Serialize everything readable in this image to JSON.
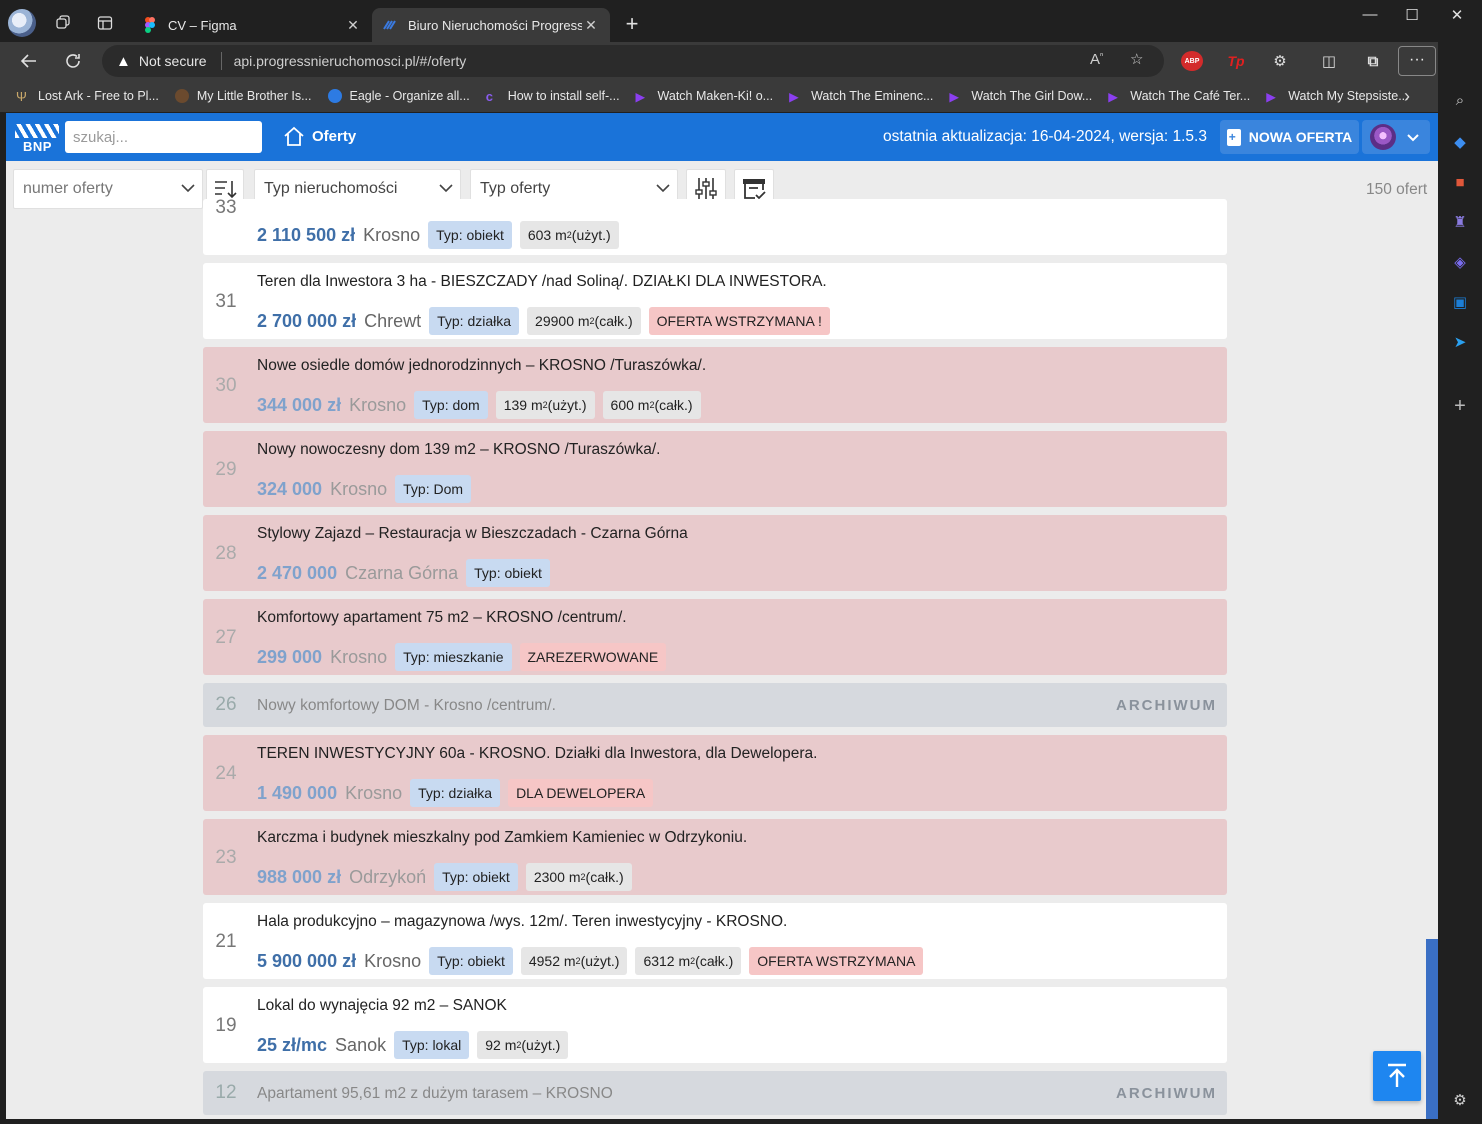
{
  "browser": {
    "tabs": [
      {
        "title": "CV – Figma",
        "active": false
      },
      {
        "title": "Biuro Nieruchomości Progress - B",
        "active": true
      }
    ],
    "not_secure": "Not secure",
    "url": "api.progressnieruchomosci.pl/#/oferty",
    "bookmarks": [
      "Lost Ark - Free to Pl...",
      "My Little Brother Is...",
      "Eagle - Organize all...",
      "How to install self-...",
      "Watch Maken-Ki! o...",
      "Watch The Eminenc...",
      "Watch The Girl Dow...",
      "Watch The Café Ter...",
      "Watch My Stepsiste..."
    ],
    "ext_abp": "ABP",
    "ext_tp": "Tp"
  },
  "app": {
    "logo": "BNP",
    "search_placeholder": "szukaj...",
    "nav_oferty": "Oferty",
    "update_text": "ostatnia aktualizacja: 16-04-2024, wersja: 1.5.3",
    "new_offer_button": "NOWA OFERTA"
  },
  "filters": {
    "offer_number_placeholder": "numer oferty",
    "property_type_placeholder": "Typ nieruchomości",
    "offer_type_placeholder": "Typ oferty",
    "count": "150 ofert"
  },
  "offers": [
    {
      "num": "33",
      "price": "2 110 500 zł",
      "city": "Krosno",
      "tags": [
        {
          "k": "typ",
          "t": "Typ: obiekt"
        },
        {
          "k": "area",
          "t": "603 m",
          "sup": "2",
          "after": "(użyt.)"
        }
      ]
    },
    {
      "num": "31",
      "title": "Teren dla Inwestora 3 ha - BIESZCZADY /nad Soliną/. DZIAŁKI DLA INWESTORA.",
      "price": "2 700 000 zł",
      "city": "Chrewt",
      "tags": [
        {
          "k": "typ",
          "t": "Typ: działka"
        },
        {
          "k": "area",
          "t": "29900 m",
          "sup": "2",
          "after": "(całk.)"
        },
        {
          "k": "stat",
          "t": "OFERTA WSTRZYMANA !"
        }
      ]
    },
    {
      "num": "30",
      "title": "Nowe osiedle domów jednorodzinnych – KROSNO /Turaszówka/.",
      "price": "344 000 zł",
      "city": "Krosno",
      "tags": [
        {
          "k": "typ",
          "t": "Typ: dom"
        },
        {
          "k": "area",
          "t": "139 m",
          "sup": "2",
          "after": "(użyt.)"
        },
        {
          "k": "area",
          "t": "600 m",
          "sup": "2",
          "after": "(całk.)"
        }
      ]
    },
    {
      "num": "29",
      "title": "Nowy nowoczesny dom 139 m2 – KROSNO /Turaszówka/.",
      "price": "324 000",
      "city": "Krosno",
      "tags": [
        {
          "k": "typ",
          "t": "Typ: Dom"
        }
      ]
    },
    {
      "num": "28",
      "title": "Stylowy Zajazd – Restauracja w Bieszczadach - Czarna Górna",
      "price": "2 470 000",
      "city": "Czarna Górna",
      "tags": [
        {
          "k": "typ",
          "t": "Typ: obiekt"
        }
      ]
    },
    {
      "num": "27",
      "title": "Komfortowy apartament 75 m2 – KROSNO /centrum/.",
      "price": "299 000",
      "city": "Krosno",
      "tags": [
        {
          "k": "typ",
          "t": "Typ: mieszkanie"
        },
        {
          "k": "stat",
          "t": "ZAREZERWOWANE"
        }
      ]
    },
    {
      "num": "26",
      "title": "Nowy komfortowy DOM - Krosno /centrum/.",
      "archive": "ARCHIWUM"
    },
    {
      "num": "24",
      "title": "TEREN INWESTYCYJNY 60a - KROSNO. Działki dla Inwestora, dla Dewelopera.",
      "price": "1 490 000",
      "city": "Krosno",
      "tags": [
        {
          "k": "typ",
          "t": "Typ: działka"
        },
        {
          "k": "stat",
          "t": "DLA DEWELOPERA"
        }
      ]
    },
    {
      "num": "23",
      "title": "Karczma i budynek mieszkalny pod Zamkiem Kamieniec w Odrzykoniu.",
      "price": "988 000 zł",
      "city": "Odrzykoń",
      "tags": [
        {
          "k": "typ",
          "t": "Typ: obiekt"
        },
        {
          "k": "area",
          "t": "2300 m",
          "sup": "2",
          "after": "(całk.)"
        }
      ]
    },
    {
      "num": "21",
      "title": "Hala produkcyjno – magazynowa /wys. 12m/. Teren inwestycyjny - KROSNO.",
      "price": "5 900 000 zł",
      "city": "Krosno",
      "tags": [
        {
          "k": "typ",
          "t": "Typ: obiekt"
        },
        {
          "k": "area",
          "t": "4952 m",
          "sup": "2",
          "after": "(użyt.)"
        },
        {
          "k": "area",
          "t": "6312 m",
          "sup": "2",
          "after": "(całk.)"
        },
        {
          "k": "stat",
          "t": "OFERTA WSTRZYMANA"
        }
      ]
    },
    {
      "num": "19",
      "title": "Lokal do wynajęcia 92 m2 – SANOK",
      "price": "25 zł/mc",
      "city": "Sanok",
      "tags": [
        {
          "k": "typ",
          "t": "Typ: lokal"
        },
        {
          "k": "area",
          "t": "92 m",
          "sup": "2",
          "after": "(użyt.)"
        }
      ]
    },
    {
      "num": "12",
      "title": "Apartament 95,61 m2 z dużym tarasem – KROSNO",
      "archive": "ARCHIWUM"
    }
  ],
  "colors": {
    "appbar": "#1a73d9",
    "price": "#3f6fa8",
    "card_red": "#e8cacc",
    "card_gray": "#d6d9de",
    "tag_typ": "#c8daf1",
    "tag_status": "#f6c6c6"
  },
  "icons": [
    "profile-icon",
    "workspaces-icon",
    "tab-actions-icon",
    "figma-icon",
    "bnp-favicon",
    "close-icon",
    "plus-icon",
    "minimize-icon",
    "maximize-icon",
    "back-icon",
    "refresh-icon",
    "warning-icon",
    "read-aloud-icon",
    "star-icon",
    "extensions-icon",
    "split-screen-icon",
    "collections-icon",
    "more-icon",
    "copilot-icon",
    "search-icon",
    "home-icon",
    "document-icon",
    "chevron-down-icon",
    "sort-icon",
    "sliders-icon",
    "archive-filter-icon",
    "arrow-up-icon"
  ]
}
